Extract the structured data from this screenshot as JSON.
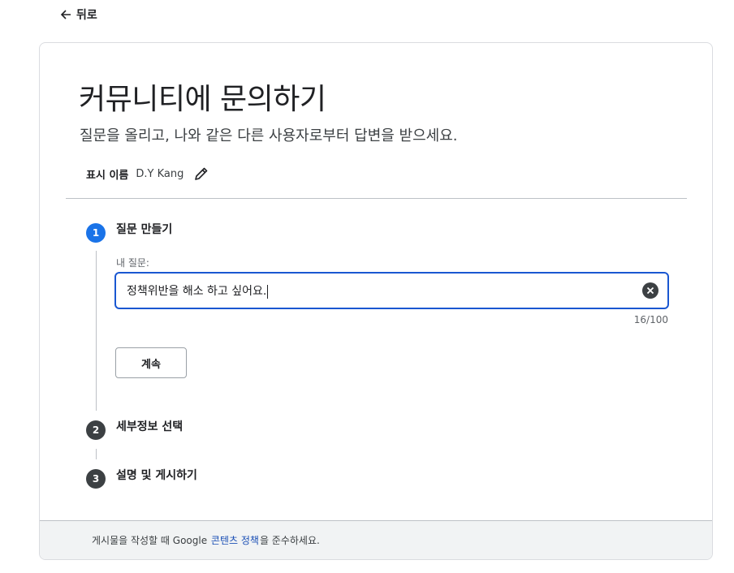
{
  "nav": {
    "back_label": "뒤로"
  },
  "page": {
    "title": "커뮤니티에 문의하기",
    "subtitle": "질문을 올리고, 나와 같은 다른 사용자로부터 답변을 받으세요."
  },
  "display_name": {
    "label": "표시 이름",
    "value": "D.Y Kang"
  },
  "steps": [
    {
      "number": "1",
      "title": "질문 만들기"
    },
    {
      "number": "2",
      "title": "세부정보 선택"
    },
    {
      "number": "3",
      "title": "설명 및 게시하기"
    }
  ],
  "question": {
    "label": "내 질문:",
    "value": "정책위반을 해소 하고 싶어요.",
    "counter": "16/100",
    "continue_label": "계속"
  },
  "footer": {
    "prefix": "게시물을 작성할 때 Google",
    "link": "콘텐츠 정책",
    "suffix": "을 준수하세요."
  },
  "colors": {
    "accent": "#1a73e8",
    "link": "#1a4fb5",
    "footer_bg": "#f1f3f4"
  }
}
